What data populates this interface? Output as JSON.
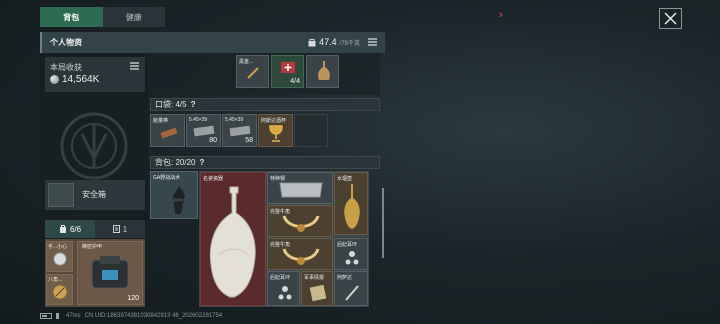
{
  "tabs": {
    "backpack": "背包",
    "health": "健康"
  },
  "header": {
    "title": "个人物资",
    "weight": "47.4",
    "weight_cap": "/78千克"
  },
  "income": {
    "label": "本局收获",
    "value": "14,564K"
  },
  "safe_box": {
    "label": "安全箱"
  },
  "mini_tabs": {
    "equip_count": "6/6",
    "other_count": "1"
  },
  "equipment": {
    "slot1": "手...小心",
    "slot2": "精密护甲",
    "slot3": "八角...",
    "durability": "120"
  },
  "top_items": [
    {
      "name": "黑金..."
    },
    {
      "name": "",
      "count": "4/4"
    },
    {
      "name": ""
    }
  ],
  "pocket": {
    "title": "口袋: 4/5",
    "help": "?",
    "items": [
      {
        "name": "能量棒",
        "count": ""
      },
      {
        "name": "5.45×39",
        "count": "80"
      },
      {
        "name": "5.45×39",
        "count": "58"
      },
      {
        "name": "阿斯达酒杯",
        "count": ""
      }
    ]
  },
  "bag": {
    "title": "背包: 20/20",
    "help": "?",
    "gun": {
      "name": "GA野战战术"
    },
    "items": [
      {
        "name": "名瓷瓷器"
      },
      {
        "name": "特种钢"
      },
      {
        "name": "水烟壶"
      },
      {
        "name": "完整牛角"
      },
      {
        "name": "完整牛角"
      },
      {
        "name": "后妃耳环"
      },
      {
        "name": "后妃耳环"
      },
      {
        "name": "军事情报"
      },
      {
        "name": "阿萨达"
      }
    ]
  },
  "footer": {
    "ping": "47ms",
    "uid": "CN UID:1863974381030842913 48_202602281754"
  },
  "colors": {
    "accent": "#2f6b53",
    "rare_red": "#5a2b2c",
    "warning": "#d8383a"
  }
}
